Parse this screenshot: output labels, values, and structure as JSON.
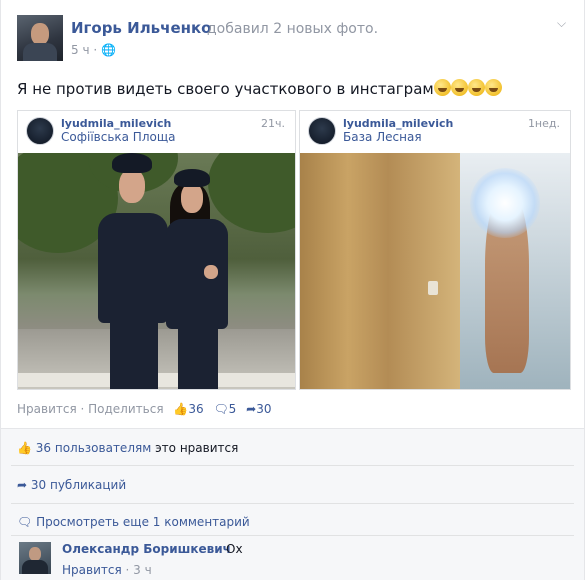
{
  "post": {
    "author": "Игорь Ильченко",
    "action": "добавил 2 новых фото.",
    "time": "5 ч",
    "audience_icon": "globe-icon",
    "text": "Я не против видеть своего участкового в инстаграм",
    "emoji_count": 4
  },
  "instagram": [
    {
      "username": "lyudmila_milevich",
      "location": "Софіївська Площа",
      "time": "21ч."
    },
    {
      "username": "lyudmila_milevich",
      "location": "База Лесная",
      "time": "1нед."
    }
  ],
  "actions": {
    "like": "Нравится",
    "share": "Поделиться",
    "likes_count": "36",
    "comments_count": "5",
    "shares_count": "30"
  },
  "ufi": {
    "likes_count_text": "36 пользователям",
    "likes_suffix": "это нравится",
    "shares_text": "30 публикаций",
    "more_comments": "Просмотреть еще 1 комментарий"
  },
  "comment": {
    "author": "Олександр Боришкевич",
    "text": "Ох",
    "like": "Нравится",
    "time": "3 ч"
  },
  "colors": {
    "link": "#3b5998",
    "muted": "#9197a3",
    "ufi_bg": "#f6f7f9"
  }
}
